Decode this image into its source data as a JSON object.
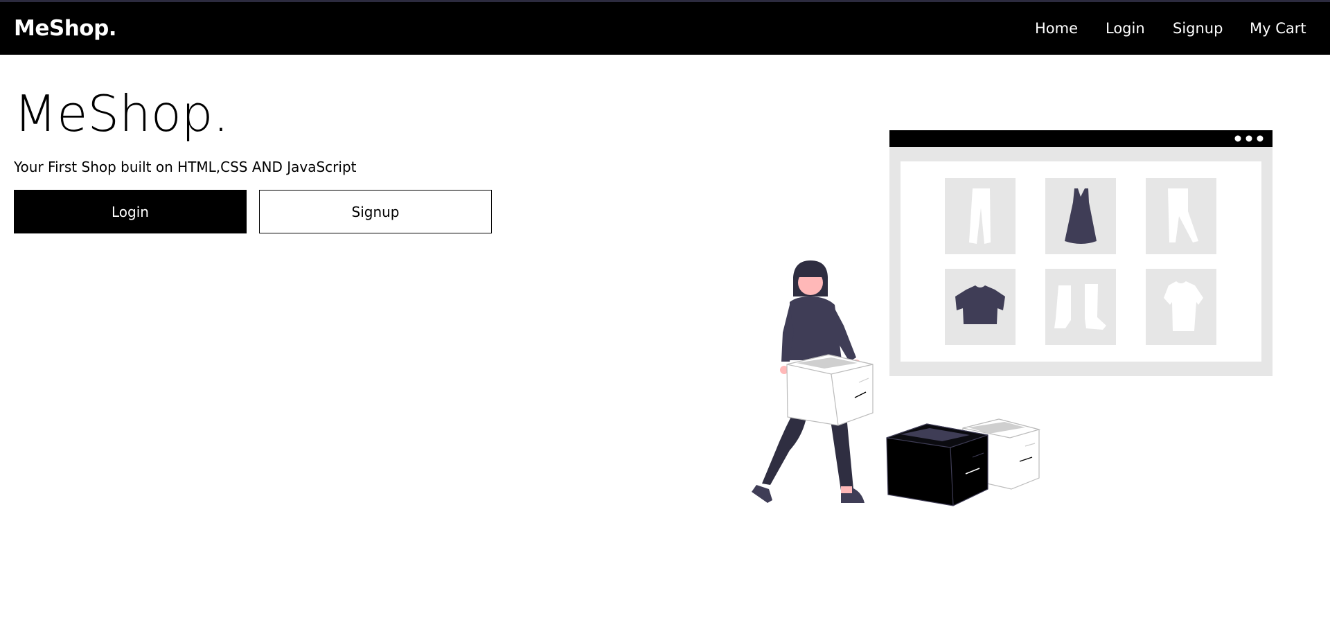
{
  "navbar": {
    "brand": "MeShop.",
    "links": [
      "Home",
      "Login",
      "Signup",
      "My Cart"
    ]
  },
  "hero": {
    "title": "MeShop.",
    "subtitle": "Your First Shop built on HTML,CSS AND JavaScript",
    "login_label": "Login",
    "signup_label": "Signup"
  },
  "colors": {
    "navbar_bg": "#000000",
    "accent_dark": "#3f3d56",
    "skin": "#ffb8b8",
    "panel_gray": "#e6e6e6"
  }
}
